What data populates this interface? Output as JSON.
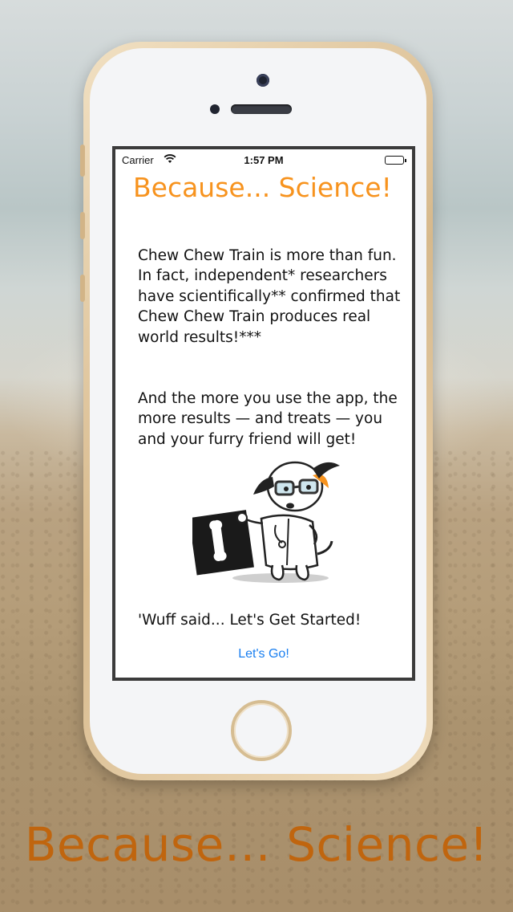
{
  "status_bar": {
    "carrier": "Carrier",
    "wifi_icon": "wifi-icon",
    "time": "1:57 PM",
    "battery_icon": "battery-icon"
  },
  "screen": {
    "title": "Because... Science!",
    "paragraph1": "Chew Chew Train is more than fun. In fact, independent* researchers have scientifically** confirmed that Chew Chew Train produces real world results!***",
    "paragraph2": "And the more you use the app, the more results — and treats — you and your furry friend will get!",
    "illustration": "scientist-dog-illustration",
    "tagline": "'Wuff said... Let's Get Started!",
    "go_button": "Let's Go!"
  },
  "caption": "Because… Science!",
  "colors": {
    "title_orange": "#f7931e",
    "caption_orange": "#c0650e",
    "link_blue": "#1a7ff0"
  }
}
